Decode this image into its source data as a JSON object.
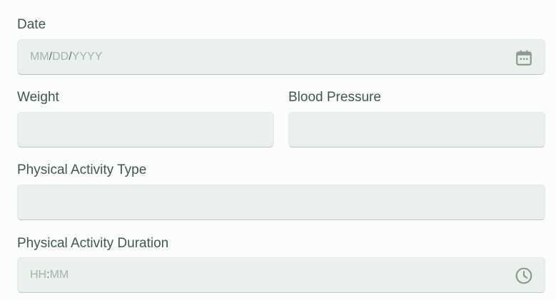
{
  "form": {
    "date": {
      "label": "Date",
      "placeholder_parts": [
        "MM",
        "/",
        "DD",
        "/",
        "YYYY"
      ],
      "icon": "calendar-icon"
    },
    "weight": {
      "label": "Weight",
      "value": ""
    },
    "blood_pressure": {
      "label": "Blood Pressure",
      "value": ""
    },
    "activity_type": {
      "label": "Physical Activity Type",
      "value": ""
    },
    "activity_duration": {
      "label": "Physical Activity Duration",
      "placeholder_parts": [
        "HH",
        ":",
        "MM"
      ],
      "icon": "clock-icon"
    }
  },
  "colors": {
    "background": "#fbfdfc",
    "field_fill": "#eaf0ec",
    "field_underline": "#b9c9bf",
    "label_text": "#41574c",
    "placeholder_text": "#a5b2ab",
    "icon": "#8a9a91"
  }
}
